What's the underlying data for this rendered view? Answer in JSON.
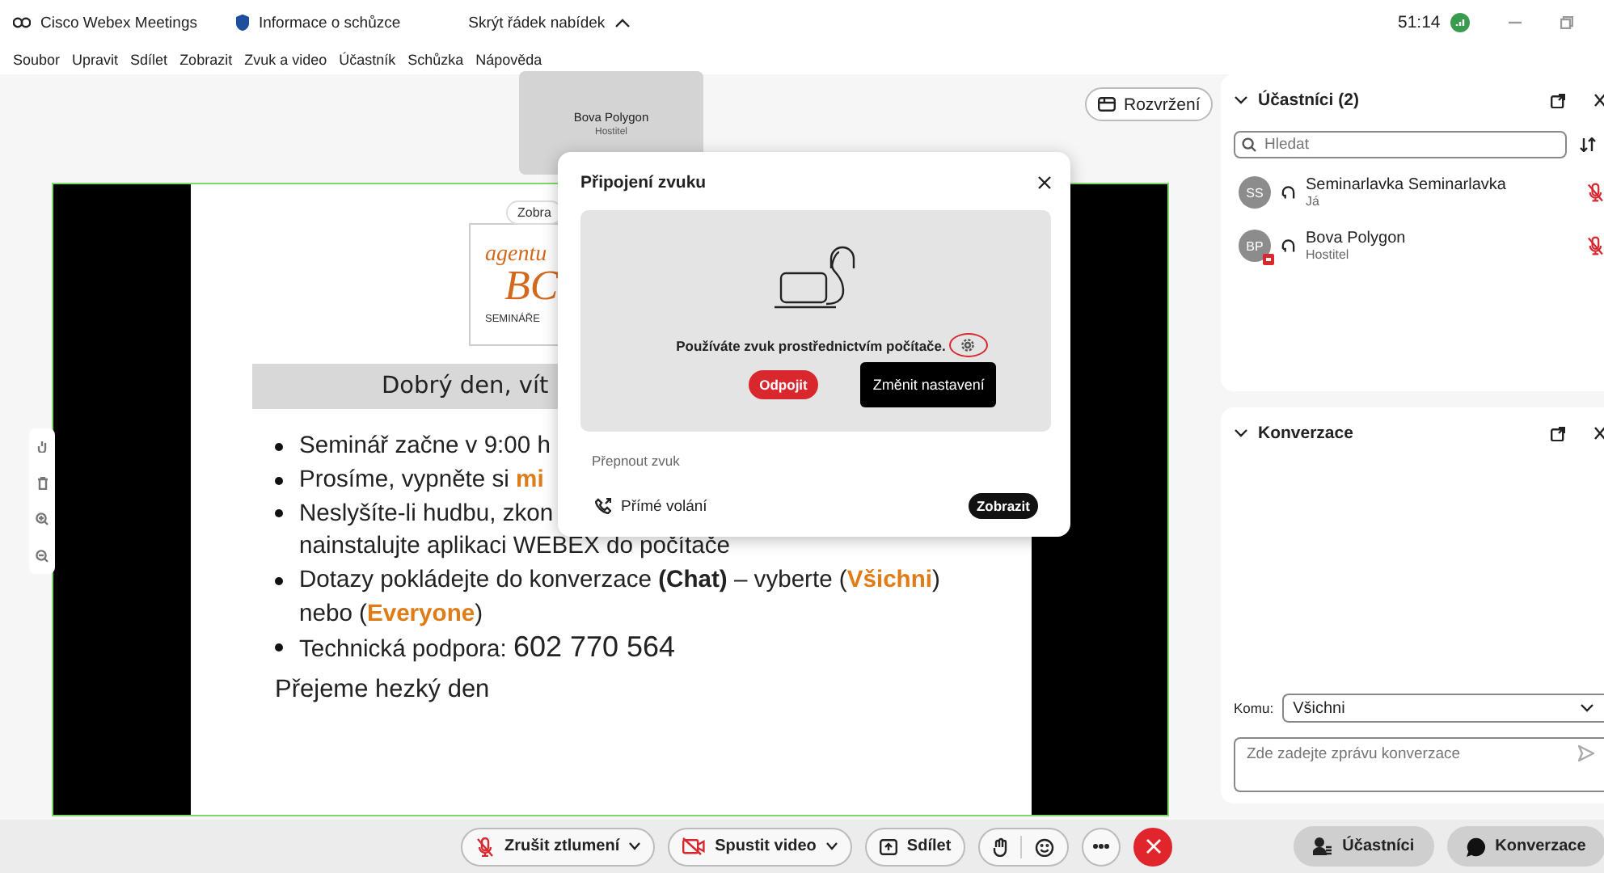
{
  "title_bar": {
    "app_name": "Cisco Webex Meetings",
    "meeting_info": "Informace o schůzce",
    "hide_menu": "Skrýt řádek nabídek",
    "timer": "51:14"
  },
  "menu": [
    "Soubor",
    "Upravit",
    "Sdílet",
    "Zobrazit",
    "Zvuk a video",
    "Účastník",
    "Schůzka",
    "Nápověda"
  ],
  "stage": {
    "video_tile": {
      "name": "Bova Polygon",
      "role": "Hostitel"
    },
    "layout_button": "Rozvržení",
    "slide": {
      "view_pill": "Zobra",
      "logo": {
        "line_1": "agentu",
        "line_2": "BC",
        "line_3": "SEMINÁŘE"
      },
      "heading": "Dobrý den, vít",
      "lines": [
        {
          "bullet": true,
          "runs": [
            {
              "kind": "plain",
              "text": "Seminář začne v 9:00 h"
            }
          ]
        },
        {
          "bullet": true,
          "runs": [
            {
              "kind": "plain",
              "text": "Prosíme, vypněte si "
            },
            {
              "kind": "highlight",
              "text": "mi"
            }
          ]
        },
        {
          "bullet": true,
          "runs": [
            {
              "kind": "plain",
              "text": "Neslyšíte-li hudbu, zkon"
            }
          ]
        },
        {
          "bullet": false,
          "runs": [
            {
              "kind": "plain",
              "text": "nainstalujte aplikaci WEBEX do počítače"
            }
          ]
        },
        {
          "bullet": true,
          "runs": [
            {
              "kind": "plain",
              "text": "Dotazy pokládejte do konverzace "
            },
            {
              "kind": "bold",
              "text": "(Chat)"
            },
            {
              "kind": "plain",
              "text": " – vyberte ("
            },
            {
              "kind": "highlight",
              "text": "Všichni"
            },
            {
              "kind": "plain",
              "text": ")"
            }
          ]
        },
        {
          "bullet": false,
          "runs": [
            {
              "kind": "plain",
              "text": "nebo ("
            },
            {
              "kind": "highlight",
              "text": "Everyone"
            },
            {
              "kind": "plain",
              "text": ")"
            }
          ]
        },
        {
          "bullet": true,
          "runs": [
            {
              "kind": "plain",
              "text": "Technická podpora: "
            },
            {
              "kind": "large",
              "text": "602 770 564"
            }
          ]
        }
      ],
      "closing": "Přejeme hezký den"
    }
  },
  "audio_dialog": {
    "title": "Připojení zvuku",
    "message": "Používáte zvuk prostřednictvím počítače.",
    "disconnect_button": "Odpojit",
    "settings_button": "Změnit nastavení",
    "switch_label": "Přepnout zvuk",
    "option": {
      "label": "Přímé volání",
      "action": "Zobrazit"
    }
  },
  "participants_panel": {
    "title": "Účastníci (2)",
    "search": {
      "placeholder": "Hledat"
    },
    "participants": [
      {
        "initials": "SS",
        "name": "Seminarlavka Seminarlavka",
        "role": "Já",
        "host": false,
        "muted": true
      },
      {
        "initials": "BP",
        "name": "Bova Polygon",
        "role": "Hostitel",
        "host": true,
        "muted": true
      }
    ]
  },
  "chat_panel": {
    "title": "Konverzace",
    "recipient_label": "Komu:",
    "recipient": "Všichni",
    "message": {
      "placeholder": "Zde zadejte zprávu konverzace"
    }
  },
  "toolbar": {
    "unmute_button": "Zrušit ztlumení",
    "video_button": "Spustit video",
    "share_button": "Sdílet",
    "participants_button": {
      "label": "Účastníci",
      "selected": true
    },
    "chat_button": {
      "label": "Konverzace",
      "selected": true
    }
  }
}
